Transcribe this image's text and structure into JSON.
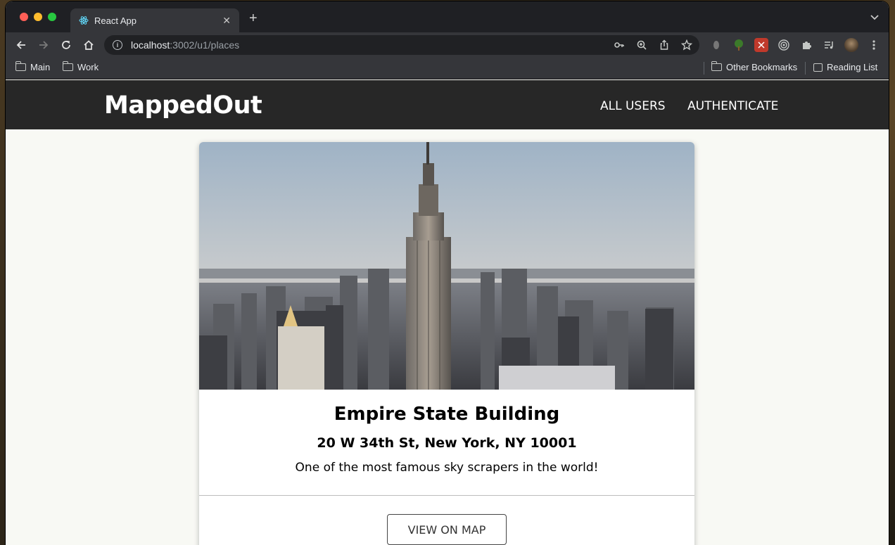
{
  "browser": {
    "tab": {
      "title": "React App"
    },
    "new_tab_symbol": "+",
    "url": {
      "host": "localhost",
      "path": ":3002/u1/places"
    },
    "bookmarks": {
      "left": [
        {
          "label": "Main"
        },
        {
          "label": "Work"
        }
      ],
      "right": [
        {
          "label": "Other Bookmarks"
        },
        {
          "label": "Reading List"
        }
      ]
    }
  },
  "app": {
    "brand": "MappedOut",
    "nav": [
      {
        "label": "ALL USERS"
      },
      {
        "label": "AUTHENTICATE"
      }
    ]
  },
  "place": {
    "title": "Empire State Building",
    "address": "20 W 34th St, New York, NY 10001",
    "description": "One of the most famous sky scrapers in the world!",
    "view_map_label": "VIEW ON MAP"
  },
  "icons": {
    "back": "arrow-left-icon",
    "forward": "arrow-right-icon",
    "reload": "reload-icon",
    "home": "home-icon",
    "key": "key-icon",
    "zoom": "zoom-icon",
    "share": "share-icon",
    "bookmark": "star-icon"
  },
  "colors": {
    "appbar": "#272727",
    "page_bg": "#f8f9f4",
    "browser_chrome": "#35363a"
  }
}
